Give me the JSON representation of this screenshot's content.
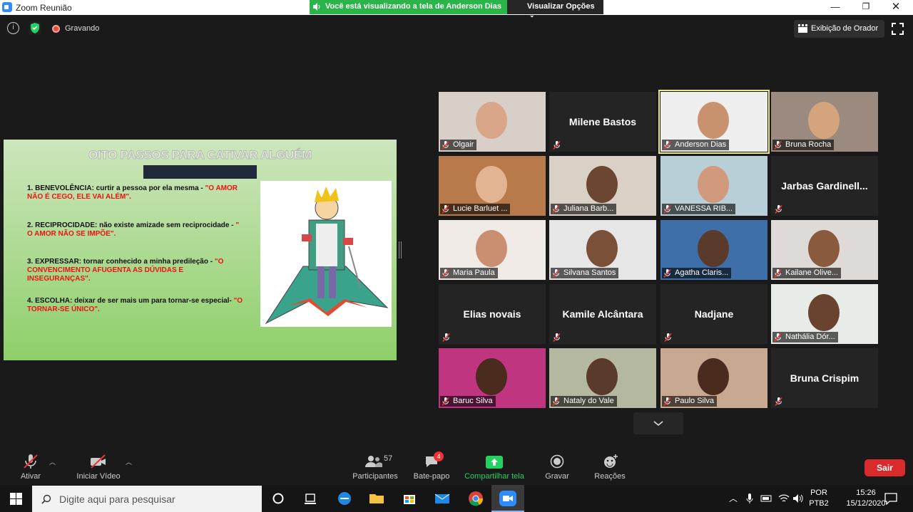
{
  "window": {
    "title": "Zoom Reunião"
  },
  "share_banner": {
    "text": "Você está visualizando a tela de Anderson Dias",
    "options_label": "Visualizar Opções"
  },
  "recording": {
    "label": "Gravando"
  },
  "view": {
    "speaker_label": "Exibição de Orador"
  },
  "slide": {
    "title": "OITO PASSOS PARA CATIVAR ALGUÉM",
    "items": [
      {
        "text": "1. BENEVOLÊNCIA: curtir a pessoa por ela mesma -",
        "highlight": "\"O AMOR NÃO É CEGO, ELE VAI ALÉM\"."
      },
      {
        "text": "2. RECIPROCIDADE: não existe amizade sem reciprocidade -",
        "highlight": "\" O AMOR NÃO SE IMPÕE\"."
      },
      {
        "text": "3. EXPRESSAR: tornar conhecido a minha predileção -",
        "highlight": "\"O CONVENCIMENTO AFUGENTA AS DÚVIDAS E INSEGURANÇAS\"."
      },
      {
        "text": "4. ESCOLHA: deixar de ser mais um para tornar-se especial-",
        "highlight": "\"O TORNAR-SE ÚNICO\"."
      }
    ]
  },
  "participants": [
    {
      "name": "Olgair",
      "video": true
    },
    {
      "name": "Milene Bastos",
      "video": false
    },
    {
      "name": "Anderson Dias",
      "video": true,
      "active": true
    },
    {
      "name": "Bruna Rocha",
      "video": true
    },
    {
      "name": "Lucie Barluet ...",
      "video": true
    },
    {
      "name": "Juliana Barb...",
      "video": true
    },
    {
      "name": "VANESSA RIB...",
      "video": true
    },
    {
      "name": "Jarbas Gardinell...",
      "video": false
    },
    {
      "name": "Maria Paula",
      "video": true
    },
    {
      "name": "Silvana Santos",
      "video": true
    },
    {
      "name": "Agatha Claris...",
      "video": true
    },
    {
      "name": "Kailane Olive...",
      "video": true
    },
    {
      "name": "Elias novais",
      "video": false
    },
    {
      "name": "Kamile Alcântara",
      "video": false
    },
    {
      "name": "Nadjane",
      "video": false
    },
    {
      "name": "Nathália Dór...",
      "video": true
    },
    {
      "name": "Baruc Silva",
      "video": true
    },
    {
      "name": "Nataly do Vale",
      "video": true
    },
    {
      "name": "Paulo Silva",
      "video": true
    },
    {
      "name": "Bruna Crispim",
      "video": false
    }
  ],
  "toolbar": {
    "mute_label": "Ativar",
    "video_label": "Iniciar Vídeo",
    "participants_label": "Participantes",
    "participants_count": "57",
    "chat_label": "Bate-papo",
    "chat_badge": "4",
    "share_label": "Compartilhar tela",
    "record_label": "Gravar",
    "reactions_label": "Reações",
    "leave_label": "Sair"
  },
  "taskbar": {
    "search_placeholder": "Digite aqui para pesquisar",
    "lang": "POR",
    "layout": "PTB2",
    "time": "15:26",
    "date": "15/12/2020"
  },
  "colors": {
    "share_green": "#2bb44a",
    "leave_red": "#d92b2b",
    "active_border": "#e9e98a"
  }
}
